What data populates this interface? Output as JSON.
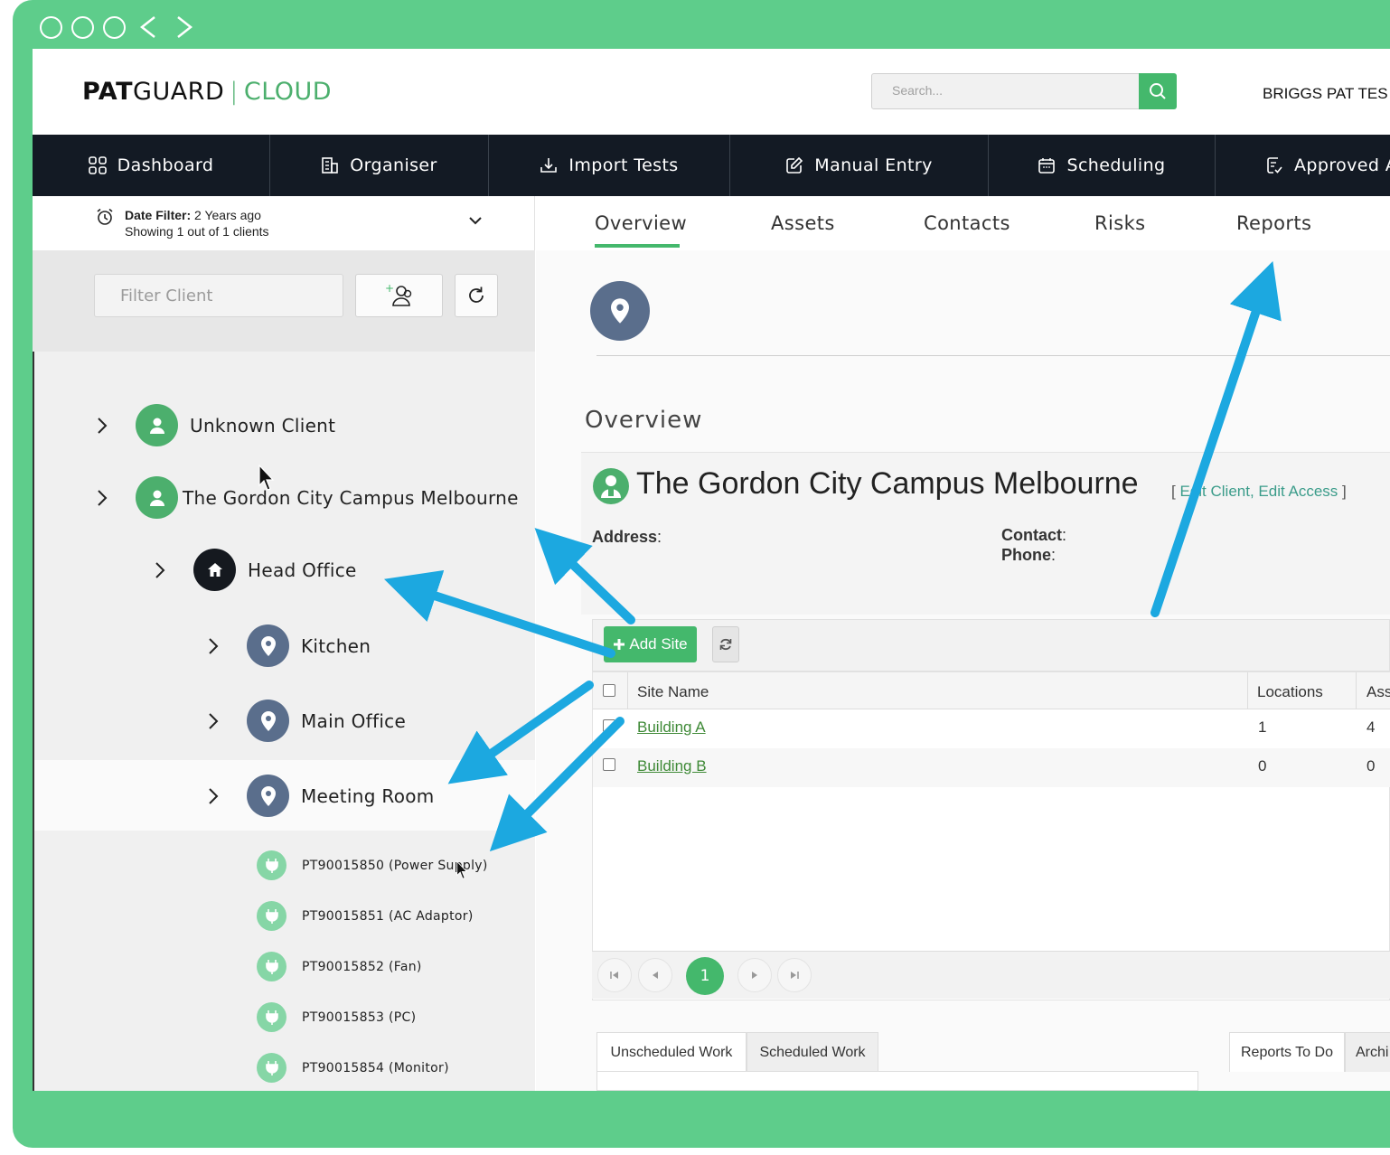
{
  "app": {
    "logo_bold": "PAT",
    "logo_regular": "GUARD",
    "logo_separator": "|",
    "logo_cloud": "CLOUD",
    "search_placeholder": "Search...",
    "user_label": "BRIGGS PAT TES"
  },
  "nav": {
    "items": [
      {
        "label": "Dashboard",
        "icon": "grid-icon"
      },
      {
        "label": "Organiser",
        "icon": "building-icon"
      },
      {
        "label": "Import Tests",
        "icon": "download-icon"
      },
      {
        "label": "Manual Entry",
        "icon": "edit-icon"
      },
      {
        "label": "Scheduling",
        "icon": "calendar-icon"
      },
      {
        "label": "Approved A",
        "icon": "clipboard-check-icon"
      }
    ]
  },
  "sidebar": {
    "date_filter_label": "Date Filter:",
    "date_filter_value": " 2 Years ago",
    "showing_text": "Showing 1 out of 1 clients",
    "filter_placeholder": "Filter Client",
    "tree": {
      "clients": [
        {
          "label": "Unknown Client"
        },
        {
          "label": "The Gordon City Campus Melbourne"
        }
      ],
      "site": {
        "label": "Head Office"
      },
      "locations": [
        {
          "label": "Kitchen"
        },
        {
          "label": "Main Office"
        },
        {
          "label": "Meeting Room"
        }
      ],
      "assets": [
        {
          "label": "PT90015850 (Power Supply)"
        },
        {
          "label": "PT90015851 (AC Adaptor)"
        },
        {
          "label": "PT90015852 (Fan)"
        },
        {
          "label": "PT90015853 (PC)"
        },
        {
          "label": "PT90015854 (Monitor)"
        }
      ]
    }
  },
  "tabs": {
    "items": [
      {
        "label": "Overview"
      },
      {
        "label": "Assets"
      },
      {
        "label": "Contacts"
      },
      {
        "label": "Risks"
      },
      {
        "label": "Reports"
      }
    ],
    "active": "Overview"
  },
  "overview": {
    "heading": "Overview",
    "client_name": "The Gordon City Campus Melbourne",
    "edit_open": "[",
    "edit_client": "Edit Client",
    "edit_sep": ",",
    "edit_access": "Edit Access",
    "edit_close": "]",
    "address_label": "Address",
    "contact_label": "Contact",
    "phone_label": "Phone",
    "colon": ":"
  },
  "sites": {
    "add_site_label": "Add Site",
    "columns": [
      "Site Name",
      "Locations",
      "Ass"
    ],
    "rows": [
      {
        "name": "Building A",
        "locations": "1",
        "assets": "4"
      },
      {
        "name": "Building B",
        "locations": "0",
        "assets": "0"
      }
    ],
    "current_page": "1"
  },
  "bottom_tabs": {
    "left": [
      "Unscheduled Work",
      "Scheduled Work"
    ],
    "right": [
      "Reports To Do",
      "Archi"
    ]
  },
  "colors": {
    "frame_green": "#5ecd8b",
    "brand_green": "#44b86c",
    "nav_dark": "#131a24",
    "location_slate": "#5a6e8c",
    "annotation_arrow": "#1ca8e0"
  }
}
